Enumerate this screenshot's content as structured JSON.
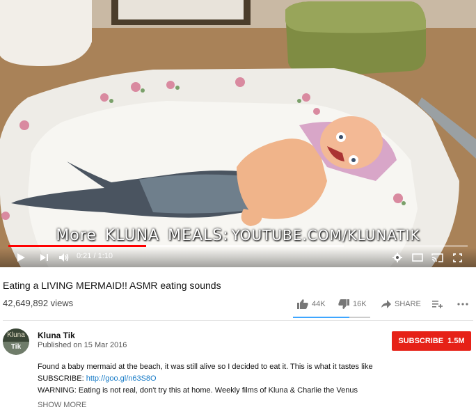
{
  "player": {
    "overlay_lead": "More",
    "overlay_brand": "KLUNA",
    "overlay_meals": "MEALS:",
    "overlay_url": "YOUTUBE.COM/KLUNATIK",
    "current_time": "0:21",
    "duration": "1:10",
    "played_fraction": 0.3,
    "loaded_fraction": 0.73,
    "icons": [
      "play-icon",
      "next-icon",
      "volume-icon",
      "settings-icon",
      "miniplayer-icon",
      "cast-icon",
      "fullscreen-icon"
    ]
  },
  "video": {
    "title": "Eating a LIVING MERMAID!! ASMR eating sounds",
    "views": "42,649,892 views",
    "likes": "44K",
    "dislikes": "16K",
    "share_label": "SHARE",
    "like_fraction": 0.73
  },
  "channel": {
    "name": "Kluna Tik",
    "published": "Published on 15 Mar 2016",
    "avatar_line1": "Kluna",
    "avatar_line2": "Tik",
    "subscribe_label": "SUBSCRIBE",
    "subscriber_count": "1.5M"
  },
  "description": {
    "line1": "Found a baby mermaid at the beach, it was still alive so I decided to eat it. This is what it tastes like",
    "line2_prefix": "SUBSCRIBE:",
    "line2_link": "http://goo.gl/n63S8O",
    "line3": "WARNING: Eating is not real, don't try this at home. Weekly films of Kluna & Charlie the Venus",
    "show_more": "SHOW MORE"
  },
  "colors": {
    "progress_played": "#ff0000",
    "subscribe_bg": "#e62117",
    "link": "#167ac6",
    "sentiment_like": "#3ea6ff"
  }
}
